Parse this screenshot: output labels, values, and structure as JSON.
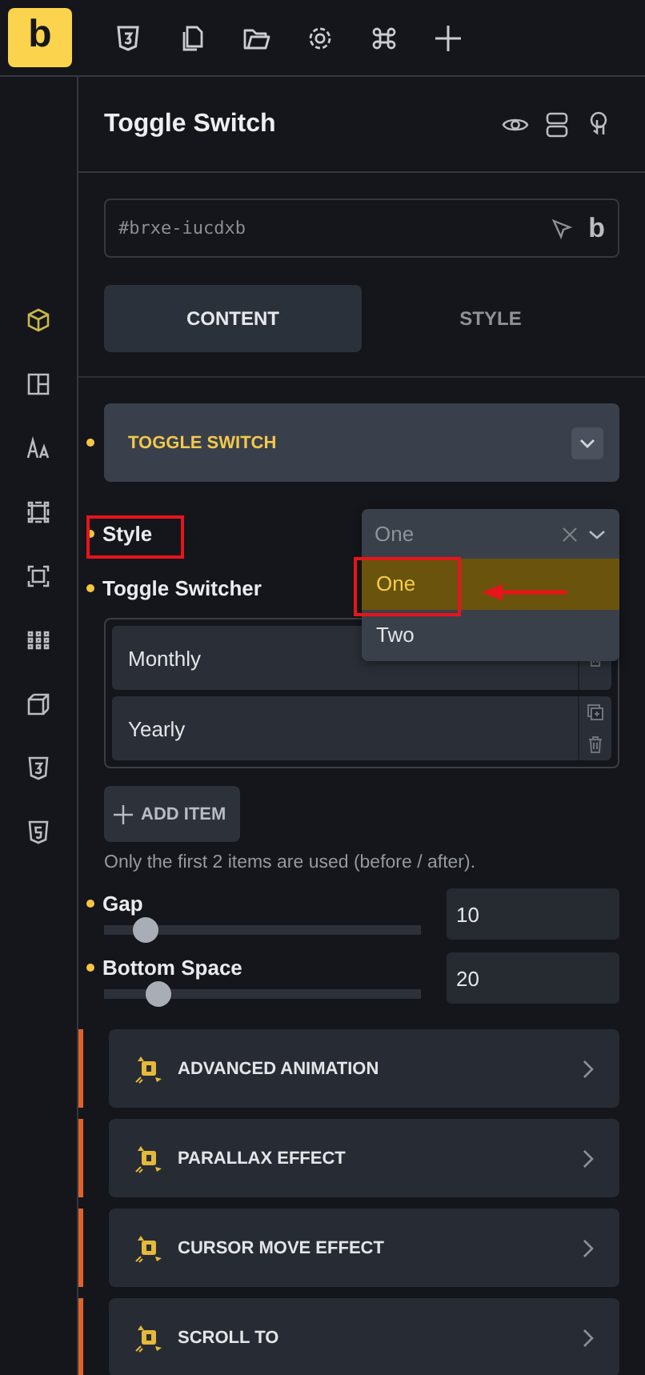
{
  "logo": "b",
  "panel": {
    "title": "Toggle Switch"
  },
  "element_id": {
    "value": "#brxe-iucdxb",
    "badge": "b"
  },
  "tabs": [
    {
      "label": "CONTENT",
      "selected": true
    },
    {
      "label": "STYLE",
      "selected": false
    }
  ],
  "sidebar_items": [
    {
      "kind": "cube",
      "selected": true
    },
    {
      "kind": "layout",
      "selected": false
    },
    {
      "kind": "typography",
      "selected": false
    },
    {
      "kind": "spacing",
      "selected": false
    },
    {
      "kind": "frame",
      "selected": false
    },
    {
      "kind": "grid",
      "selected": false
    },
    {
      "kind": "box3d",
      "selected": false
    },
    {
      "kind": "css",
      "selected": false
    },
    {
      "kind": "html",
      "selected": false
    }
  ],
  "section": {
    "title": "TOGGLE SWITCH",
    "expanded": true
  },
  "style_field": {
    "label": "Style",
    "value": "One",
    "options": [
      {
        "label": "One",
        "selected": true
      },
      {
        "label": "Two",
        "selected": false
      }
    ]
  },
  "repeater": {
    "label": "Toggle Switcher",
    "items": [
      {
        "label": "Monthly"
      },
      {
        "label": "Yearly"
      }
    ],
    "add_button": "ADD ITEM",
    "note": "Only the first 2 items are used (before / after)."
  },
  "sliders": [
    {
      "label": "Gap",
      "level": 0.09,
      "value": "10"
    },
    {
      "label": "Bottom Space",
      "level": 0.13,
      "value": "20"
    }
  ],
  "accordions": [
    {
      "title": "ADVANCED ANIMATION"
    },
    {
      "title": "PARALLAX EFFECT"
    },
    {
      "title": "CURSOR MOVE EFFECT"
    },
    {
      "title": "SCROLL TO"
    }
  ]
}
